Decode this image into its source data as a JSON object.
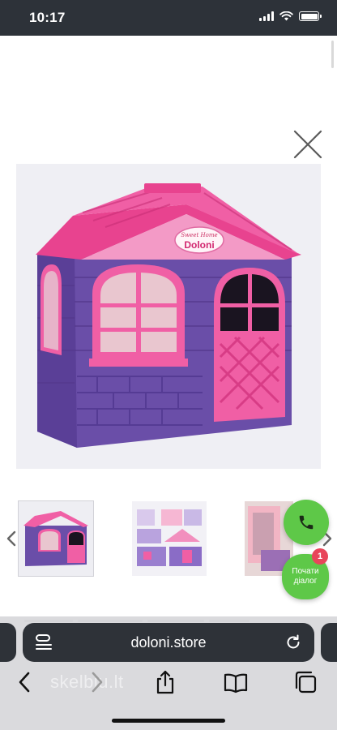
{
  "status_bar": {
    "time": "10:17",
    "icons": [
      "cellular-signal-icon",
      "wifi-icon",
      "battery-icon"
    ]
  },
  "viewer": {
    "close_icon": "close-icon",
    "main_image": {
      "subject": "Doloni toy playhouse",
      "logo_text": "Doloni",
      "logo_script": "Sweet Home"
    },
    "thumbnails": [
      {
        "icon": "thumbnail-house"
      },
      {
        "icon": "thumbnail-parts"
      },
      {
        "icon": "thumbnail-interior"
      }
    ],
    "prev_icon": "chevron-left-icon",
    "next_icon": "chevron-right-icon"
  },
  "widget": {
    "call_icon": "phone-icon",
    "chat_line1": "Почати",
    "chat_line2": "діалог",
    "badge_count": "1"
  },
  "browser": {
    "url": "doloni.store",
    "settings_icon": "page-settings-icon",
    "reload_icon": "reload-icon",
    "toolbar": [
      "back-icon",
      "forward-icon",
      "share-icon",
      "bookmarks-icon",
      "tabs-icon"
    ],
    "watermark": "skelbiu.lt"
  },
  "colors": {
    "status_bar": "#2d3239",
    "house_purple": "#6b4fae",
    "house_pink": "#f05fa5",
    "widget_green": "#5ec848",
    "badge_red": "#e8455a"
  }
}
